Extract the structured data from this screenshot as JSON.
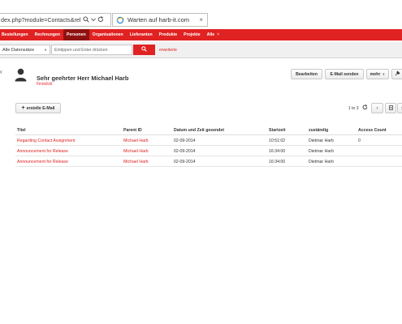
{
  "browser": {
    "url": "dex.php?module=Contacts&rel",
    "tab_title": "Warten auf harb-it.com",
    "tab_close": "×",
    "icons": [
      "search-icon",
      "dropdown-icon",
      "refresh-icon",
      "ie-loading-icon",
      "close-icon"
    ]
  },
  "nav": {
    "items": [
      {
        "label": "Bestellungen",
        "active": false
      },
      {
        "label": "Rechnungen",
        "active": false
      },
      {
        "label": "Personen",
        "active": true
      },
      {
        "label": "Organisationen",
        "active": false
      },
      {
        "label": "Lieferanten",
        "active": false
      },
      {
        "label": "Produkte",
        "active": false
      },
      {
        "label": "Projekte",
        "active": false
      },
      {
        "label": "Alle",
        "active": false
      }
    ],
    "more_caret": "˅"
  },
  "search": {
    "datasets_label": "Alle Datensätze",
    "placeholder": "Eintippen und Enter drücken",
    "advanced_link": "erweiterte"
  },
  "record": {
    "title": "Sehr geehrter Herr Michael Harb",
    "subtitle": "Firstclick",
    "buttons": {
      "edit": "Bearbeiten",
      "send_email": "E-Mail senden",
      "more": "mehr"
    }
  },
  "subpanel": {
    "create_label": "erstelle E-Mail",
    "pager": "1 to 3",
    "columns": [
      "Titel",
      "Parent ID",
      "Datum und Zeit gesendet",
      "Startzeit",
      "zuständig",
      "Access Count"
    ],
    "rows": [
      {
        "title": "Regarding Contact Assignment",
        "parent": "Michael Harb",
        "date": "02-09-2014",
        "start": "10:51:02",
        "assigned": "Dietmar Harb",
        "access": "0"
      },
      {
        "title": "Announcement for Release",
        "parent": "Michael Harb",
        "date": "02-09-2014",
        "start": "16:34:00",
        "assigned": "Dietmar Harb",
        "access": ""
      },
      {
        "title": "Announcement for Release",
        "parent": "Michael Harb",
        "date": "02-09-2014",
        "start": "16:34:00",
        "assigned": "Dietmar Harb",
        "access": ""
      }
    ]
  },
  "colors": {
    "brand_red": "#e02222",
    "active_nav": "#8f1212"
  }
}
